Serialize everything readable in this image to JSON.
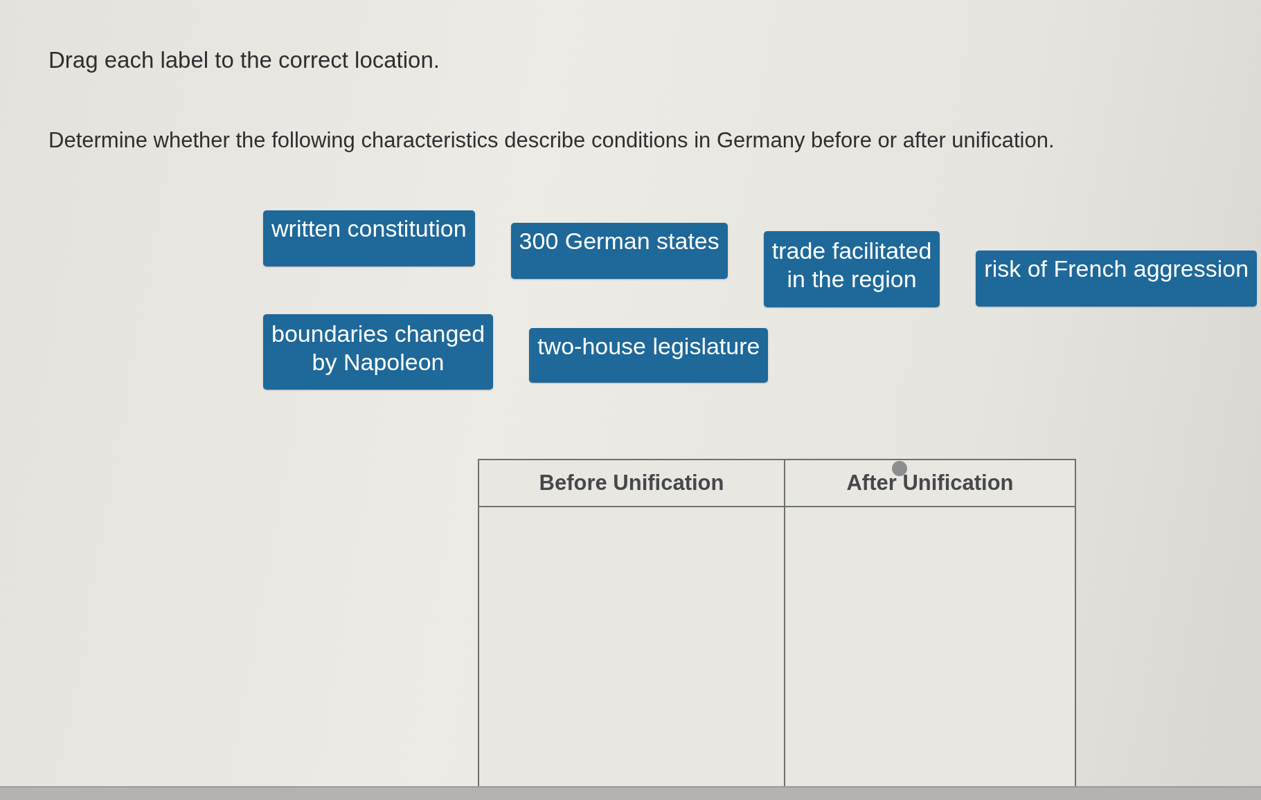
{
  "instructions": [
    "Drag each label to the correct location.",
    "Determine whether the following characteristics describe conditions in Germany before or after unification."
  ],
  "label_rows": [
    [
      {
        "lines": [
          "written constitution"
        ]
      },
      {
        "lines": [
          "300 German states"
        ]
      },
      {
        "lines": [
          "trade facilitated",
          "in the region"
        ]
      },
      {
        "lines": [
          "risk of French aggression"
        ]
      }
    ],
    [
      {
        "lines": [
          "boundaries changed",
          "by Napoleon"
        ]
      },
      {
        "lines": [
          "two-house legislature"
        ]
      }
    ]
  ],
  "drop_table": {
    "columns": [
      "Before Unification",
      "After Unification"
    ]
  }
}
